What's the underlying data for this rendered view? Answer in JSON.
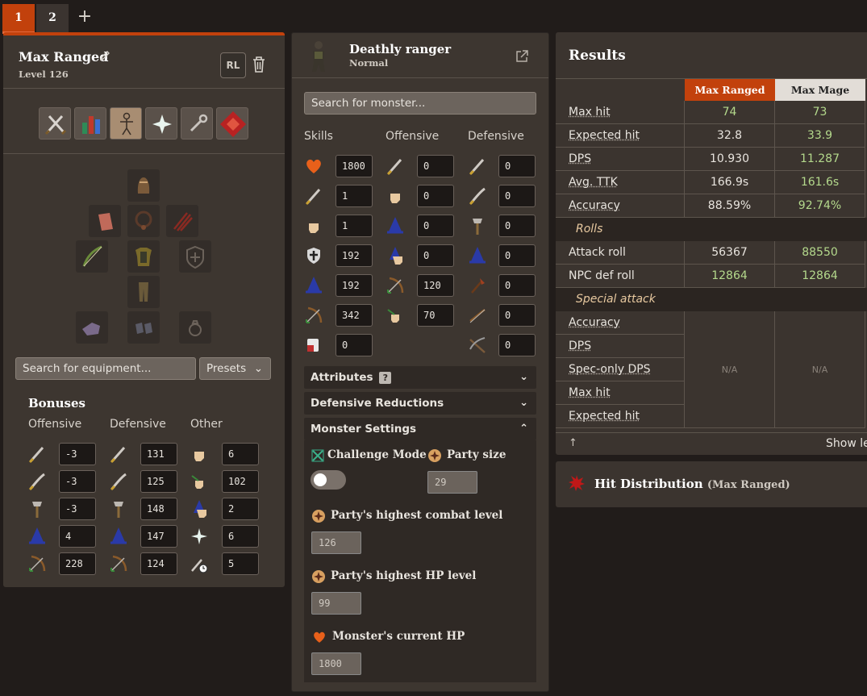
{
  "tabs": [
    {
      "label": "1"
    },
    {
      "label": "2"
    }
  ],
  "tab_add": "+",
  "loadout": {
    "name": "Max Ranged",
    "level": "Level 126",
    "runelite_label": "RL",
    "equipment_search_placeholder": "Search for equipment...",
    "presets_label": "Presets",
    "bonuses": {
      "title": "Bonuses",
      "headers": [
        "Offensive",
        "Defensive",
        "Other"
      ],
      "offensive": [
        "-3",
        "-3",
        "-3",
        "4",
        "228"
      ],
      "defensive": [
        "131",
        "125",
        "148",
        "147",
        "124"
      ],
      "other": [
        "6",
        "102",
        "2",
        "6",
        "5"
      ]
    }
  },
  "monster": {
    "name": "Deathly ranger",
    "variant": "Normal",
    "search_placeholder": "Search for monster...",
    "headers": [
      "Skills",
      "Offensive",
      "Defensive"
    ],
    "skills": [
      "1800",
      "1",
      "1",
      "192",
      "192",
      "342",
      "0"
    ],
    "offensive": [
      "0",
      "0",
      "0",
      "0",
      "120",
      "70"
    ],
    "defensive": [
      "0",
      "0",
      "0",
      "0",
      "0",
      "0",
      "0"
    ],
    "attributes_label": "Attributes",
    "attributes_help": "?",
    "defensive_reductions_label": "Defensive Reductions",
    "monster_settings_label": "Monster Settings",
    "challenge_mode_label": "Challenge Mode",
    "party_size_label": "Party size",
    "party_size": "29",
    "party_combat_label": "Party's highest combat level",
    "party_combat": "126",
    "party_hp_label": "Party's highest HP level",
    "party_hp": "99",
    "current_hp_label": "Monster's current HP",
    "current_hp": "1800"
  },
  "results": {
    "title": "Results",
    "columns": [
      "Max Ranged",
      "Max Mage"
    ],
    "rows": [
      {
        "label": "Max hit",
        "v1": "74",
        "v2": "73"
      },
      {
        "label": "Expected hit",
        "v1": "32.8",
        "v2": "33.9"
      },
      {
        "label": "DPS",
        "v1": "10.930",
        "v2": "11.287"
      },
      {
        "label": "Avg. TTK",
        "v1": "166.9s",
        "v2": "161.6s"
      },
      {
        "label": "Accuracy",
        "v1": "88.59%",
        "v2": "92.74%"
      }
    ],
    "rolls_label": "Rolls",
    "roll_rows": [
      {
        "label": "Attack roll",
        "v1": "56367",
        "v2": "88550"
      },
      {
        "label": "NPC def roll",
        "v1": "12864",
        "v2": "12864"
      }
    ],
    "special_label": "Special attack",
    "special_rows": [
      "Accuracy",
      "DPS",
      "Spec-only DPS",
      "Max hit",
      "Expected hit"
    ],
    "special_na": "N/A",
    "show_label": "Show le",
    "up_arrow": "↑"
  },
  "hit_distribution": {
    "title": "Hit Distribution",
    "subtitle": "(Max Ranged)"
  },
  "colors": {
    "accent": "#c2410c",
    "panel": "#3d3630",
    "background": "#211c1a",
    "positive": "#b4d98c"
  }
}
